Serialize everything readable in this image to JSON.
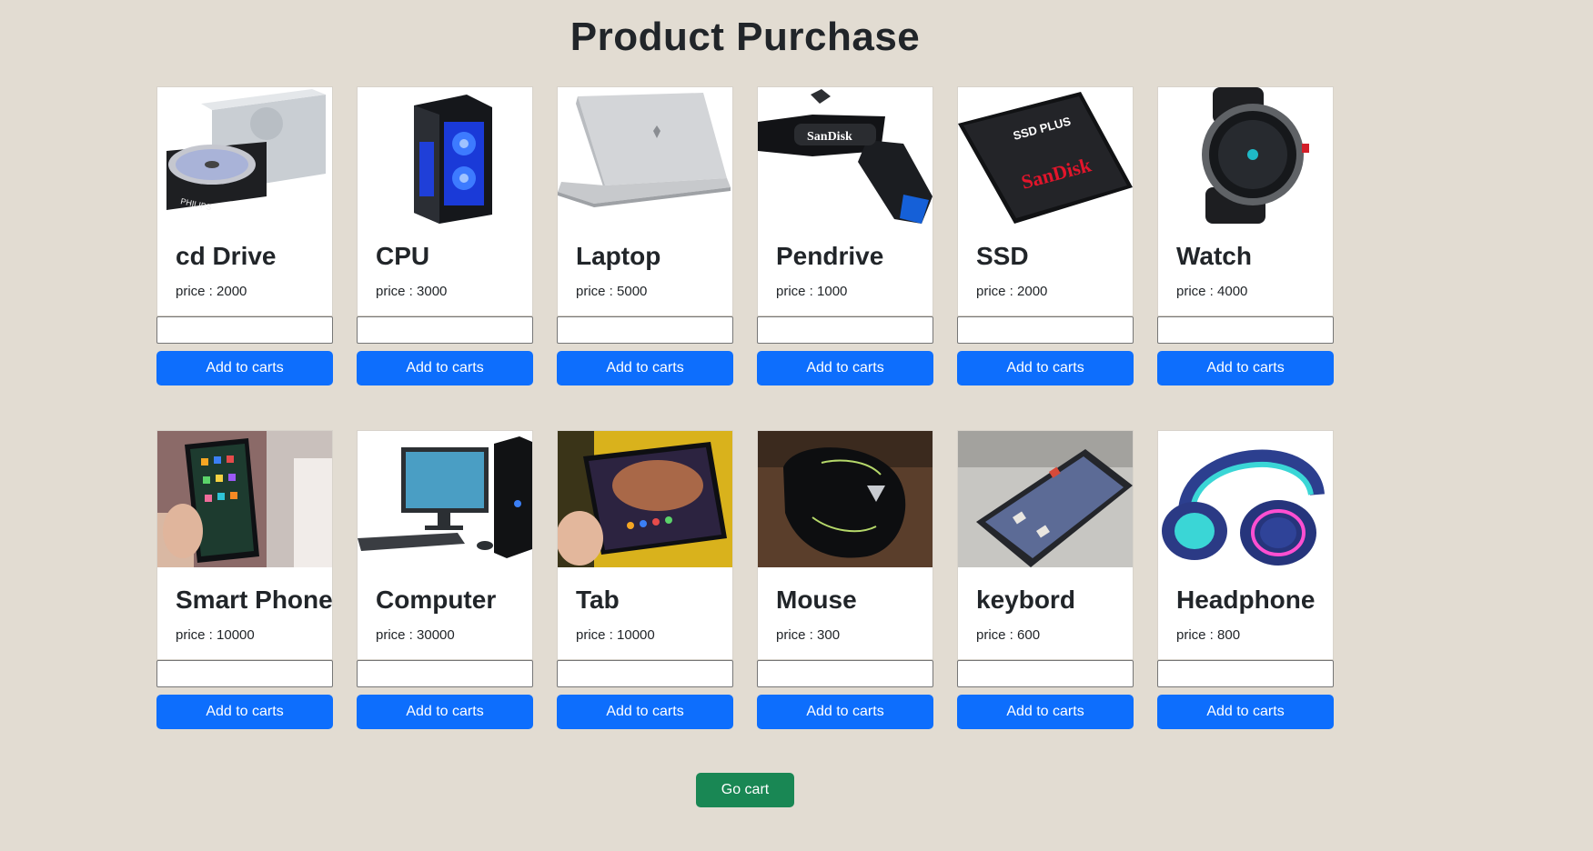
{
  "page": {
    "title": "Product Purchase",
    "go_cart_label": "Go cart"
  },
  "colors": {
    "background": "#e2dcd2",
    "primary_button": "#0d6efd",
    "success_button": "#198754"
  },
  "products": [
    {
      "name": "cd Drive",
      "price_text": "price : 2000",
      "button_label": "Add to carts",
      "image": "cd-drive-image",
      "quantity": ""
    },
    {
      "name": "CPU",
      "price_text": "price : 3000",
      "button_label": "Add to carts",
      "image": "cpu-tower-image",
      "quantity": ""
    },
    {
      "name": "Laptop",
      "price_text": "price : 5000",
      "button_label": "Add to carts",
      "image": "laptop-image",
      "quantity": ""
    },
    {
      "name": "Pendrive",
      "price_text": "price : 1000",
      "button_label": "Add to carts",
      "image": "usb-drive-image",
      "quantity": ""
    },
    {
      "name": "SSD",
      "price_text": "price : 2000",
      "button_label": "Add to carts",
      "image": "ssd-image",
      "quantity": ""
    },
    {
      "name": "Watch",
      "price_text": "price : 4000",
      "button_label": "Add to carts",
      "image": "smartwatch-image",
      "quantity": ""
    },
    {
      "name": "Smart Phone",
      "price_text": "price : 10000",
      "button_label": "Add to carts",
      "image": "smartphone-image",
      "quantity": ""
    },
    {
      "name": "Computer",
      "price_text": "price : 30000",
      "button_label": "Add to carts",
      "image": "desktop-computer-image",
      "quantity": ""
    },
    {
      "name": "Tab",
      "price_text": "price : 10000",
      "button_label": "Add to carts",
      "image": "tablet-image",
      "quantity": ""
    },
    {
      "name": "Mouse",
      "price_text": "price : 300",
      "button_label": "Add to carts",
      "image": "gaming-mouse-image",
      "quantity": ""
    },
    {
      "name": "keybord",
      "price_text": "price : 600",
      "button_label": "Add to carts",
      "image": "keyboard-image",
      "quantity": ""
    },
    {
      "name": "Headphone",
      "price_text": "price : 800",
      "button_label": "Add to carts",
      "image": "headphones-image",
      "quantity": ""
    }
  ],
  "brand_marks": {
    "cd_drive": "PHILIPS",
    "pendrive": "SanDisk",
    "ssd_top": "SSD PLUS",
    "ssd_brand": "SanDisk"
  }
}
